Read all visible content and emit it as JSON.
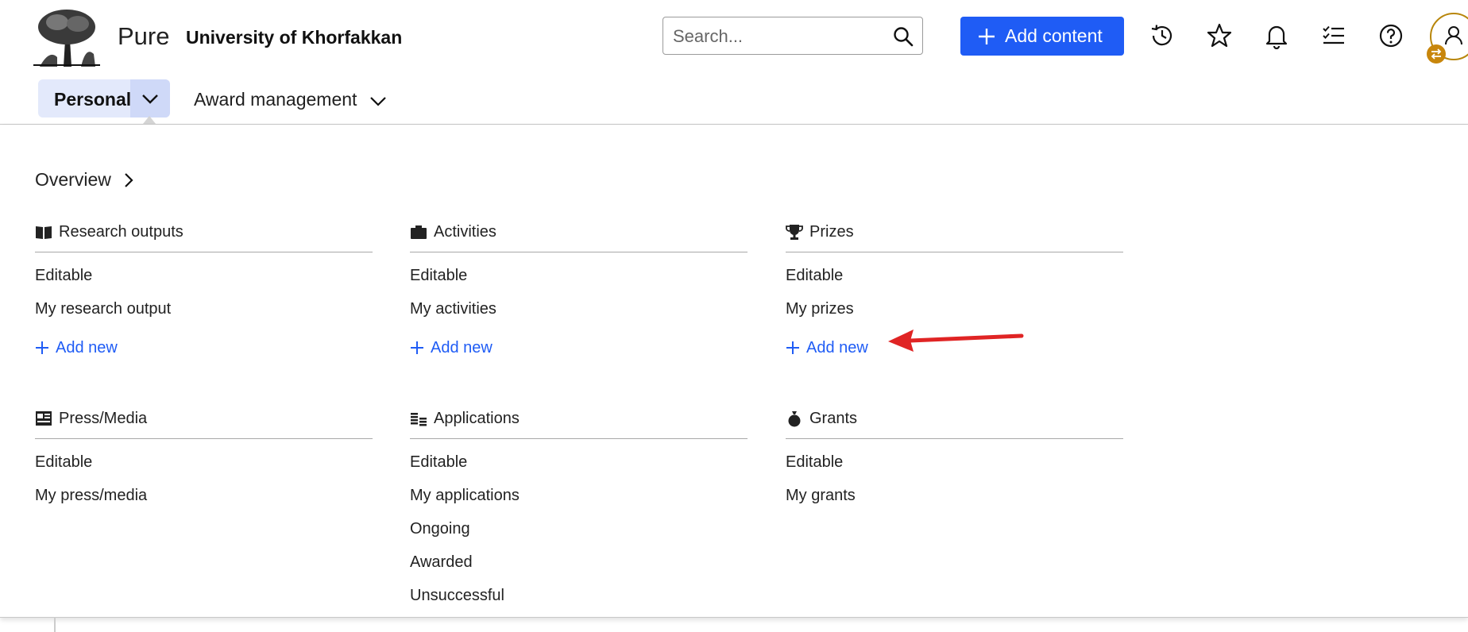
{
  "header": {
    "brand": "Pure",
    "organization": "University of Khorfakkan",
    "search": {
      "placeholder": "Search..."
    },
    "add_content_label": "Add content",
    "icons": [
      "history-icon",
      "star-icon",
      "bell-icon",
      "checklist-icon",
      "help-icon",
      "user-icon"
    ]
  },
  "nav": {
    "tabs": [
      {
        "label": "Personal",
        "active": true
      },
      {
        "label": "Award management",
        "active": false
      }
    ]
  },
  "menu": {
    "overview_label": "Overview",
    "sections": [
      {
        "title": "Research outputs",
        "icon": "book-icon",
        "items": [
          "Editable",
          "My research output"
        ],
        "add_new": "Add new"
      },
      {
        "title": "Activities",
        "icon": "briefcase-icon",
        "items": [
          "Editable",
          "My activities"
        ],
        "add_new": "Add new"
      },
      {
        "title": "Prizes",
        "icon": "trophy-icon",
        "items": [
          "Editable",
          "My prizes"
        ],
        "add_new": "Add new"
      },
      {
        "title": "Press/Media",
        "icon": "newspaper-icon",
        "items": [
          "Editable",
          "My press/media"
        ]
      },
      {
        "title": "Applications",
        "icon": "coins-icon",
        "items": [
          "Editable",
          "My applications",
          "Ongoing",
          "Awarded",
          "Unsuccessful"
        ]
      },
      {
        "title": "Grants",
        "icon": "money-bag-icon",
        "items": [
          "Editable",
          "My grants"
        ]
      }
    ]
  },
  "colors": {
    "accent": "#1f5cf5",
    "tab_bg": "#e3e9fb",
    "annotation_arrow": "#e02424",
    "avatar_ring": "#b8860b"
  }
}
